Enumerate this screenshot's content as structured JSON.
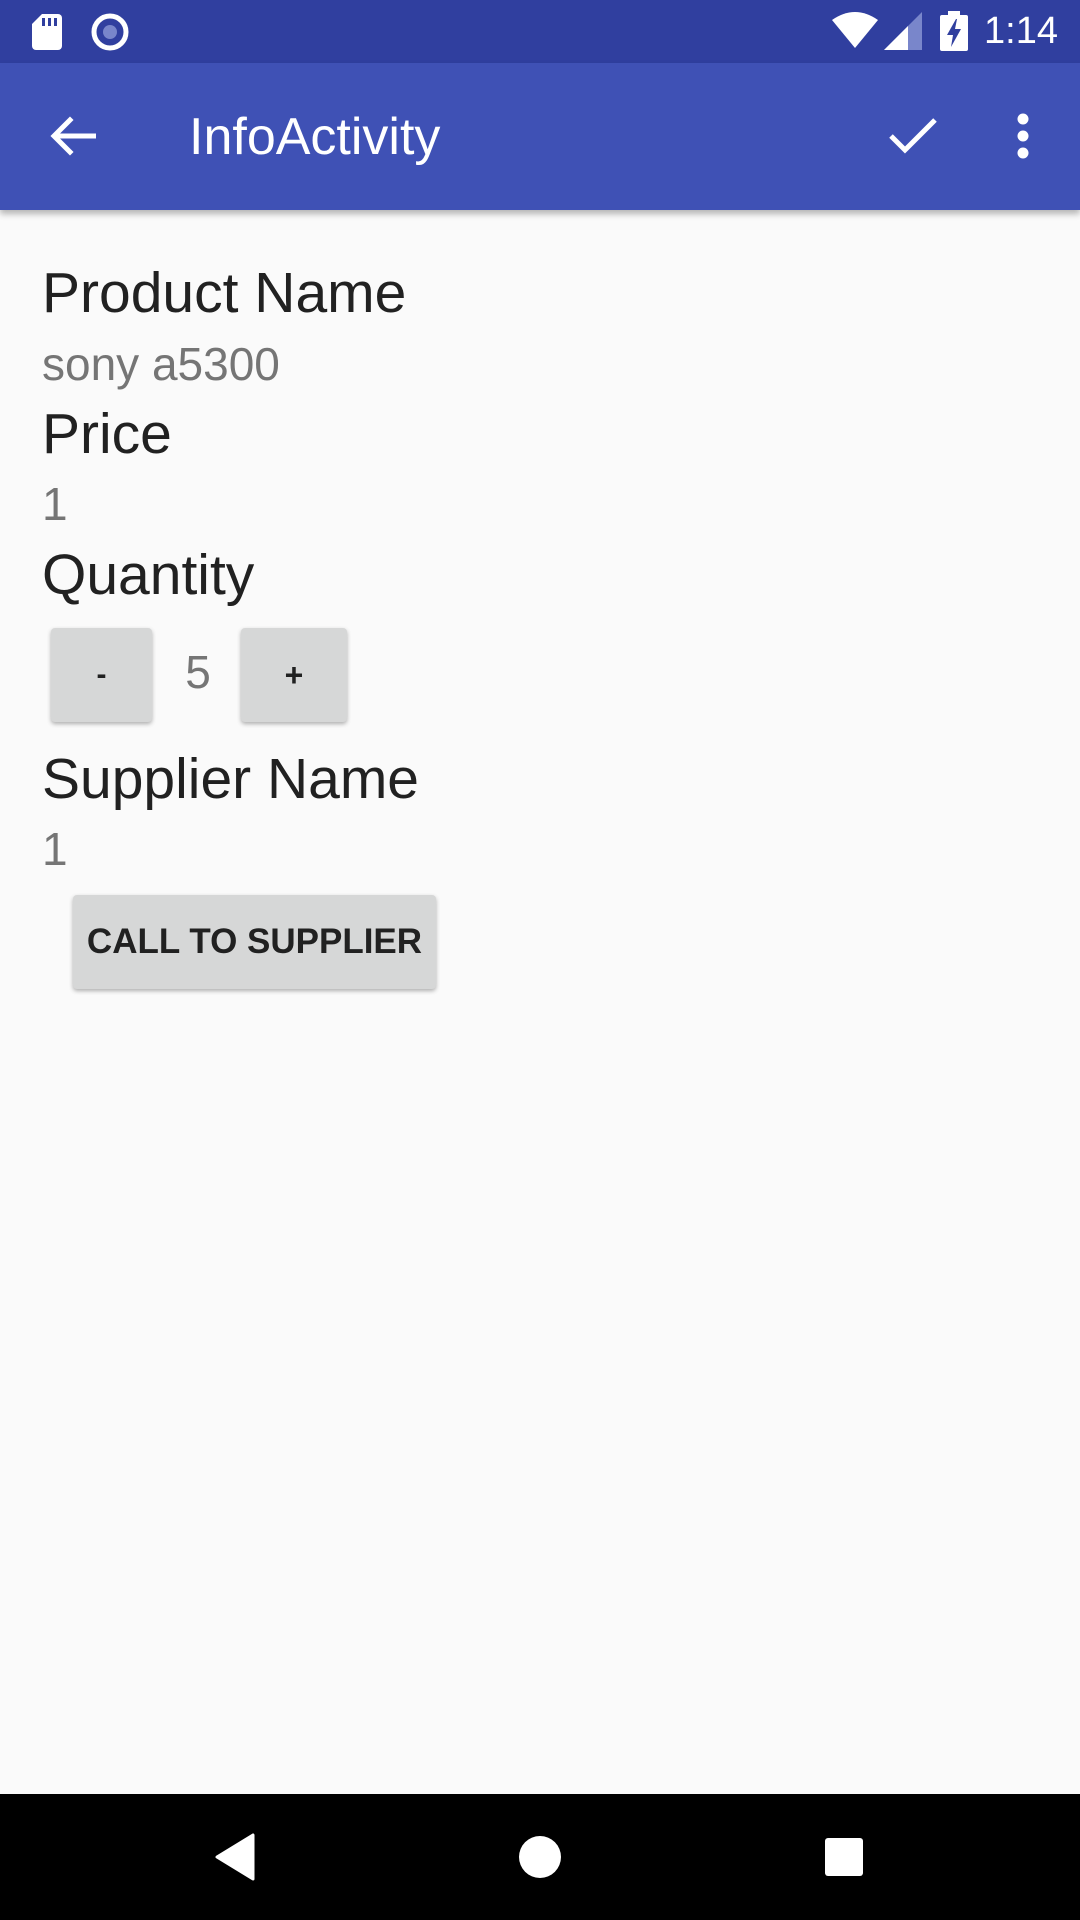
{
  "status_bar": {
    "time": "1:14",
    "icons": [
      "sd-card-icon",
      "radio-icon",
      "wifi-icon",
      "signal-icon",
      "battery-charging-icon"
    ]
  },
  "app_bar": {
    "title": "InfoActivity",
    "icons": [
      "back-arrow-icon",
      "check-icon",
      "more-vert-icon"
    ]
  },
  "fields": {
    "product_name_label": "Product Name",
    "product_name_value": "sony a5300",
    "price_label": "Price",
    "price_value": "1",
    "quantity_label": "Quantity",
    "quantity_value": "5",
    "supplier_name_label": "Supplier Name",
    "supplier_name_value": "1"
  },
  "buttons": {
    "decrement": "-",
    "increment": "+",
    "call_supplier": "CALL TO SUPPLIER"
  },
  "nav_bar": {
    "icons": [
      "nav-back-icon",
      "nav-home-icon",
      "nav-recents-icon"
    ]
  },
  "colors": {
    "status_bar": "#303f9f",
    "app_bar": "#3f51b5",
    "background": "#fafafa",
    "button": "#d6d7d7"
  }
}
